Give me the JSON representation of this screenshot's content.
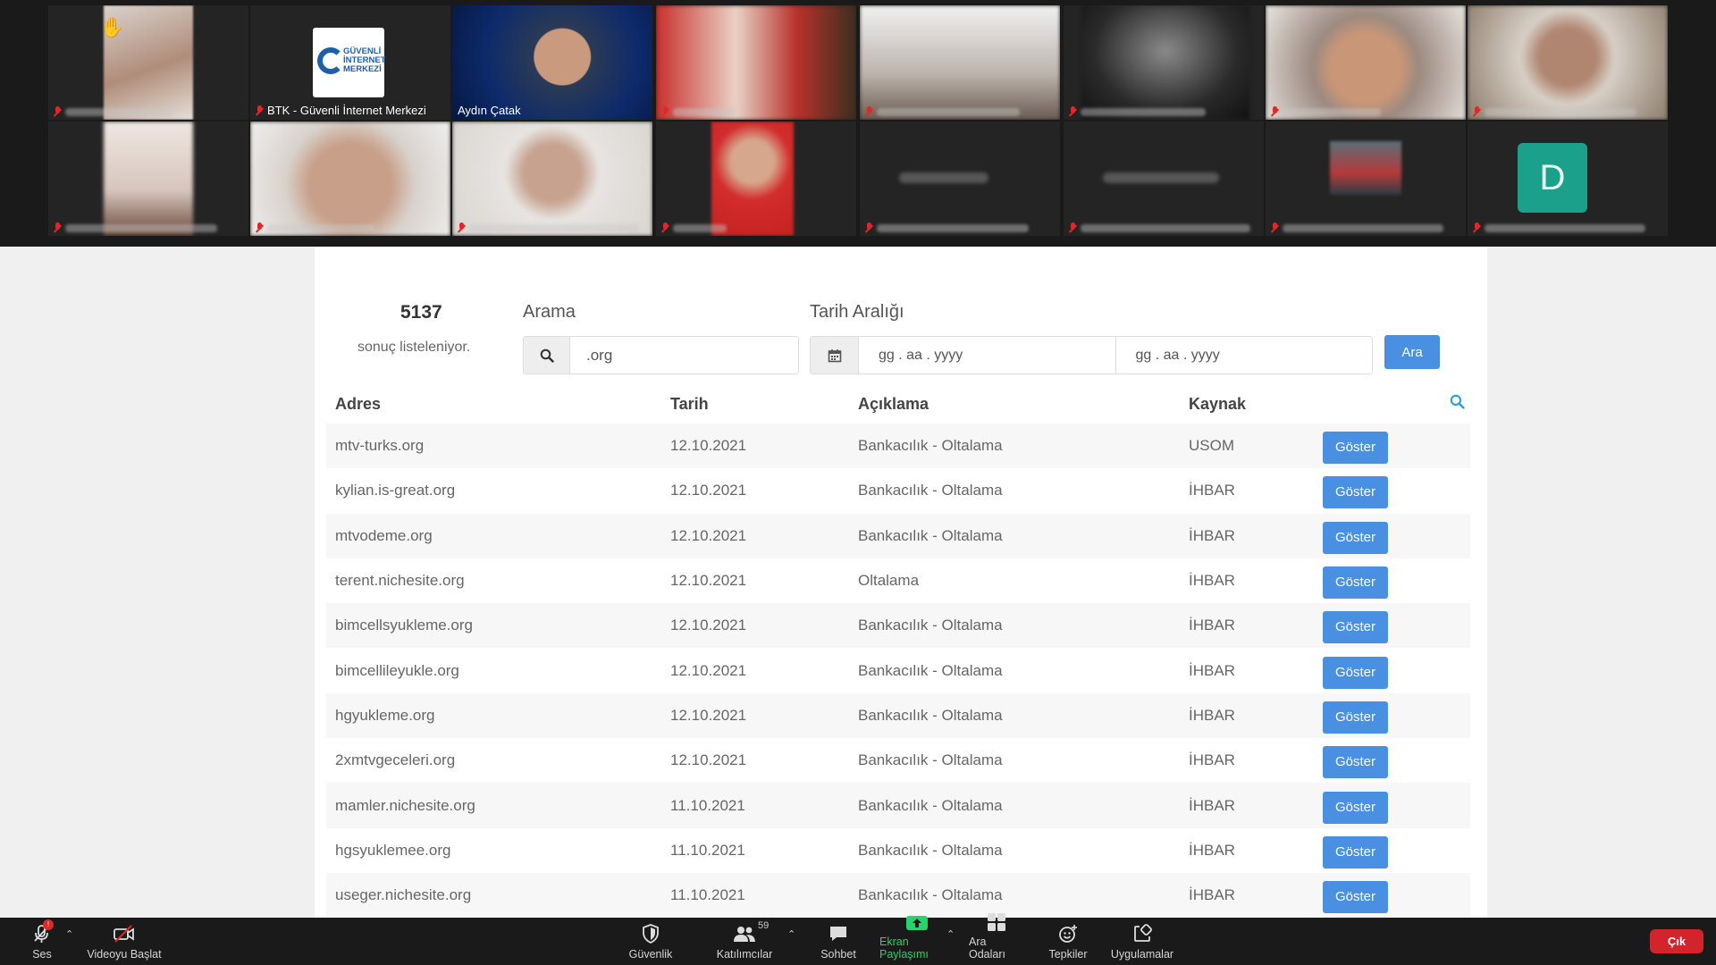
{
  "raised_hand_icon": "raised-hand-icon",
  "gallery": {
    "tiles": [
      {
        "name": "BTK - Güvenli İnternet Merkezi",
        "logo_text": "GÜVENLİ İNTERNET MERKEZİ"
      },
      {
        "name": "Aydın Çatak"
      }
    ],
    "avatar_letter": "D"
  },
  "page": {
    "result_count": "5137",
    "result_text": "sonuç listeleniyor.",
    "search_label": "Arama",
    "search_value": ".org",
    "date_label": "Tarih Aralığı",
    "date_placeholder_start": "gg . aa . yyyy",
    "date_placeholder_end": "gg . aa . yyyy",
    "search_button": "Ara",
    "columns": [
      "Adres",
      "Tarih",
      "Açıklama",
      "Kaynak"
    ],
    "show_button": "Göster",
    "rows": [
      {
        "address": "mtv-turks.org",
        "date": "12.10.2021",
        "description": "Bankacılık - Oltalama",
        "source": "USOM"
      },
      {
        "address": "kylian.is-great.org",
        "date": "12.10.2021",
        "description": "Bankacılık - Oltalama",
        "source": "İHBAR"
      },
      {
        "address": "mtvodeme.org",
        "date": "12.10.2021",
        "description": "Bankacılık - Oltalama",
        "source": "İHBAR"
      },
      {
        "address": "terent.nichesite.org",
        "date": "12.10.2021",
        "description": "Oltalama",
        "source": "İHBAR"
      },
      {
        "address": "bimcellsyukleme.org",
        "date": "12.10.2021",
        "description": "Bankacılık - Oltalama",
        "source": "İHBAR"
      },
      {
        "address": "bimcellileyukle.org",
        "date": "12.10.2021",
        "description": "Bankacılık - Oltalama",
        "source": "İHBAR"
      },
      {
        "address": "hgyukleme.org",
        "date": "12.10.2021",
        "description": "Bankacılık - Oltalama",
        "source": "İHBAR"
      },
      {
        "address": "2xmtvgeceleri.org",
        "date": "12.10.2021",
        "description": "Bankacılık - Oltalama",
        "source": "İHBAR"
      },
      {
        "address": "mamler.nichesite.org",
        "date": "11.10.2021",
        "description": "Bankacılık - Oltalama",
        "source": "İHBAR"
      },
      {
        "address": "hgsyuklemee.org",
        "date": "11.10.2021",
        "description": "Bankacılık - Oltalama",
        "source": "İHBAR"
      },
      {
        "address": "useger.nichesite.org",
        "date": "11.10.2021",
        "description": "Bankacılık - Oltalama",
        "source": "İHBAR"
      }
    ]
  },
  "toolbar": {
    "audio": "Ses",
    "audio_badge": "!",
    "video": "Videoyu Başlat",
    "security": "Güvenlik",
    "participants": "Katılımcılar",
    "participants_count": "59",
    "chat": "Sohbet",
    "share_screen": "Ekran Paylaşımı",
    "breakout": "Ara Odaları",
    "reactions": "Tepkiler",
    "apps": "Uygulamalar",
    "leave": "Çık"
  },
  "colors": {
    "accent_blue": "#4a90e2",
    "active_speaker": "#f2d230",
    "share_green": "#27d36c",
    "leave_red": "#d3242b"
  }
}
